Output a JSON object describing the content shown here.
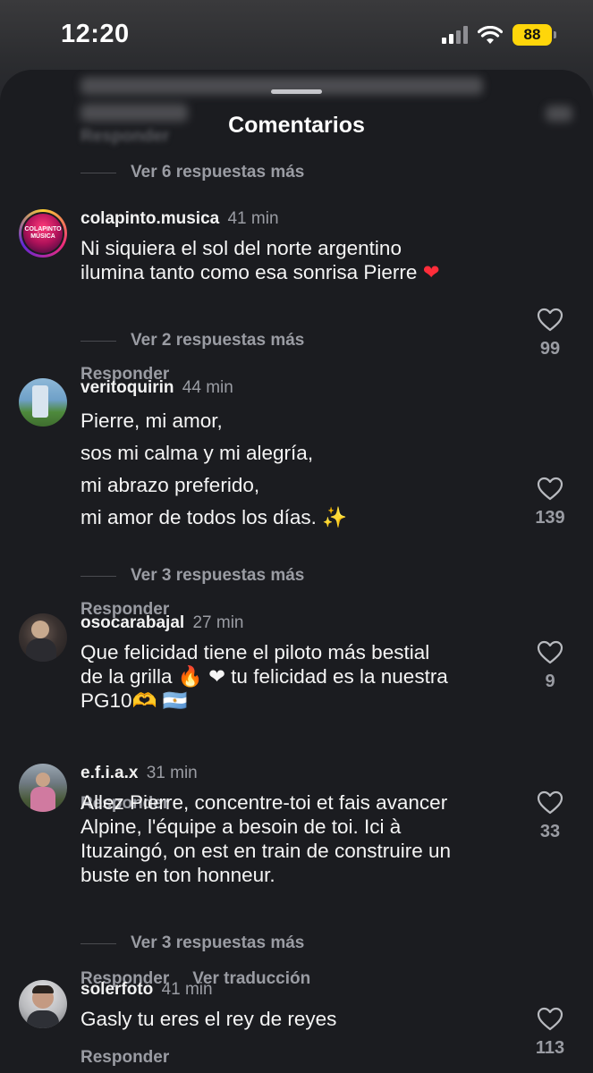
{
  "status_bar": {
    "time": "12:20",
    "battery": "88"
  },
  "sheet": {
    "title": "Comentarios",
    "blurred_reply_label": "Responder"
  },
  "top_more_replies": "Ver 6 respuestas más",
  "comments": [
    {
      "username": "colapinto.musica",
      "time": "41 min",
      "avatar_text": "COLAPINTO MÚSICA",
      "lines": [
        "Ni siquiera el sol del norte argentino",
        "ilumina tanto como esa sonrisa Pierre"
      ],
      "emoji_after": "❤",
      "likes": "99",
      "reply_label": "Responder",
      "more_replies": "Ver 2 respuestas más"
    },
    {
      "username": "veritoquirin",
      "time": "44 min",
      "lines": [
        "Pierre, mi amor,",
        "sos mi calma y mi alegría,",
        "mi abrazo preferido,",
        "mi amor de todos los días."
      ],
      "emoji_after": "✨",
      "likes": "139",
      "reply_label": "Responder",
      "more_replies": "Ver 3 respuestas más"
    },
    {
      "username": "osocarabajal",
      "time": "27 min",
      "lines": [
        "Que felicidad tiene el piloto más bestial",
        "de la grilla 🔥 ❤ tu felicidad es la nuestra",
        "PG10🫶 🇦🇷"
      ],
      "likes": "9",
      "reply_label": "Responder"
    },
    {
      "username": "e.f.i.a.x",
      "time": "31 min",
      "lines": [
        "Allez Pierre, concentre-toi et fais avancer",
        "Alpine, l'équipe a besoin de toi. Ici à",
        "Ituzaingó, on est en train de construire un",
        "buste en ton honneur."
      ],
      "likes": "33",
      "reply_label": "Responder",
      "translate_label": "Ver traducción",
      "more_replies": "Ver 3 respuestas más"
    },
    {
      "username": "solerfoto",
      "time": "41 min",
      "lines": [
        "Gasly tu eres el rey de reyes"
      ],
      "likes": "113",
      "reply_label": "Responder"
    }
  ]
}
